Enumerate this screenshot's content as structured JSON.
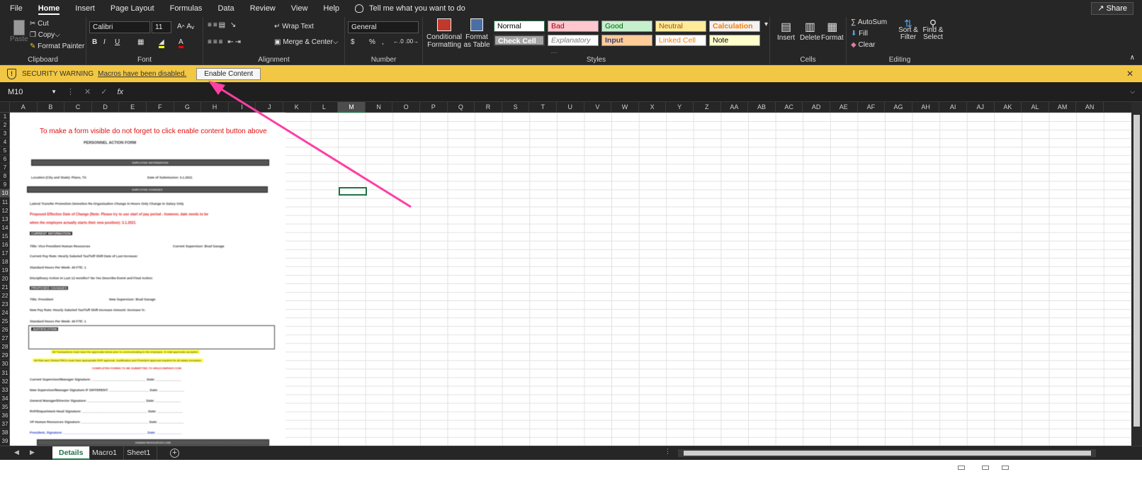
{
  "menu": {
    "items": [
      "File",
      "Home",
      "Insert",
      "Page Layout",
      "Formulas",
      "Data",
      "Review",
      "View",
      "Help"
    ],
    "tell_me": "Tell me what you want to do",
    "share": "Share"
  },
  "ribbon": {
    "clipboard": {
      "label": "Clipboard",
      "paste": "Paste",
      "cut": "Cut",
      "copy": "Copy",
      "format_painter": "Format Painter"
    },
    "font": {
      "label": "Font",
      "name": "Calibri",
      "size": "11",
      "bold": "B",
      "italic": "I",
      "underline": "U"
    },
    "alignment": {
      "label": "Alignment",
      "wrap": "Wrap Text",
      "merge": "Merge & Center"
    },
    "number": {
      "label": "Number",
      "format": "General",
      "currency": "$",
      "percent": "%",
      "comma": ","
    },
    "styles": {
      "label": "Styles",
      "conditional": "Conditional Formatting",
      "format_table": "Format as Table",
      "cells": [
        {
          "name": "Normal",
          "bg": "#ffffff",
          "fg": "#000000"
        },
        {
          "name": "Bad",
          "bg": "#ffc7ce",
          "fg": "#9c0006"
        },
        {
          "name": "Good",
          "bg": "#c6efce",
          "fg": "#006100"
        },
        {
          "name": "Neutral",
          "bg": "#ffeb9c",
          "fg": "#9c5700"
        },
        {
          "name": "Calculation",
          "bg": "#f2f2f2",
          "fg": "#fa7d00"
        },
        {
          "name": "Check Cell",
          "bg": "#a5a5a5",
          "fg": "#ffffff"
        },
        {
          "name": "Explanatory ...",
          "bg": "#ffffff",
          "fg": "#7f7f7f"
        },
        {
          "name": "Input",
          "bg": "#ffcc99",
          "fg": "#3f3f76"
        },
        {
          "name": "Linked Cell",
          "bg": "#ffffff",
          "fg": "#fa7d00"
        },
        {
          "name": "Note",
          "bg": "#ffffcc",
          "fg": "#000000"
        }
      ]
    },
    "cells": {
      "label": "Cells",
      "insert": "Insert",
      "delete": "Delete",
      "format": "Format"
    },
    "editing": {
      "label": "Editing",
      "autosum": "AutoSum",
      "fill": "Fill",
      "clear": "Clear",
      "sort": "Sort & Filter",
      "find": "Find & Select"
    }
  },
  "security": {
    "title": "SECURITY WARNING",
    "message": "Macros have been disabled.",
    "button": "Enable Content"
  },
  "formula": {
    "namebox": "M10",
    "fx": "fx",
    "value": ""
  },
  "columns": [
    "A",
    "B",
    "C",
    "D",
    "E",
    "F",
    "G",
    "H",
    "I",
    "J",
    "K",
    "L",
    "M",
    "N",
    "O",
    "P",
    "Q",
    "R",
    "S",
    "T",
    "U",
    "V",
    "W",
    "X",
    "Y",
    "Z",
    "AA",
    "AB",
    "AC",
    "AD",
    "AE",
    "AF",
    "AG",
    "AH",
    "AI",
    "AJ",
    "AK",
    "AL",
    "AM",
    "AN"
  ],
  "selected_column": "M",
  "selected_row": "10",
  "rows": [
    "1",
    "2",
    "3",
    "4",
    "5",
    "6",
    "7",
    "8",
    "9",
    "10",
    "11",
    "12",
    "13",
    "14",
    "15",
    "16",
    "17",
    "18",
    "19",
    "20",
    "21",
    "22",
    "23",
    "24",
    "25",
    "26",
    "27",
    "28",
    "29",
    "30",
    "31",
    "32",
    "33",
    "34",
    "35",
    "36",
    "37",
    "38",
    "39"
  ],
  "sheet_note": "To make a form visible do not forget to click enable content button above",
  "form": {
    "title": "PERSONNEL ACTION FORM",
    "sec_employee": "EMPLOYEE INFORMATION",
    "location": "Location (City and State): Plano, TX",
    "date_sub": "Date of Submission: 3.1.2021",
    "sec_changes": "EMPLOYEE CHANGES",
    "checks": "Lateral Transfer  Promotion  Demotion  Re-Organization  Change in Hours Only  Change in Salary Only",
    "proposed_note": "Proposed Effective Date of Change (Note: Please try to use start of pay period - however, date needs to be",
    "proposed_note2": "when the employee actually starts their new position): 3.1.2021",
    "current": "CURRENT INFORMATION",
    "title_line": "Title: Vice President Human Resources",
    "cur_sup": "Current Supervisor: Brad Savage",
    "pay": "Current Pay Rate:      Hourly   Salaried   Tax/Tuff Shift   Date of Last Increase:",
    "hours": "Standard Hours Per Week: 40   FTE: 1",
    "disc": "Disciplinary Action in Last 12 months?  No  Yes  Describe Event and Final Action:",
    "proposed": "PROPOSED CHANGES",
    "new_title": "Title: President",
    "new_sup": "New Supervisor: Brad Savage",
    "new_pay": "New Pay Rate:      Hourly   Salaried   Tax/Tuff Shift   Increase Amount:      Increase %:",
    "new_hours": "Standard Hours Per Week: 40   FTE: 1",
    "justification": "JUSTIFICATION",
    "yellow1": "All Transactions must have the approvals below prior to communicating to the employee. E-mail approvals accepted.",
    "yellow2": "All Risk and Clinical PMCs must have appropriate RVP approval.      Justification and President approval required for all salary increases.",
    "red_submit": "COMPLETED FORMS TO BE SUBMITTED TO HR@COMPANY.COM",
    "sig1": "Current Supervisor/Manager Signature: ______________________________  Date: ______________",
    "sig2": "New Supervisor/Manager Signature IF DIFFERENT: ______________________  Date: ______________",
    "sig3": "General Manager/Director Signature: ________________________________  Date: ______________",
    "sig4": "RVP/Department Head Signature: ____________________________________  Date: ______________",
    "sig5": "VP Human Resources Signature: _____________________________________  Date: ______________",
    "sig6": "President, Signature: ______________________________________________  Date: ______________",
    "sec_hr": "HUMAN RESOURCES USE"
  },
  "tabs": [
    "Details",
    "Macro1",
    "Sheet1"
  ],
  "active_tab": "Details",
  "accent": "#217346",
  "arrow_color": "#ff3fa4"
}
